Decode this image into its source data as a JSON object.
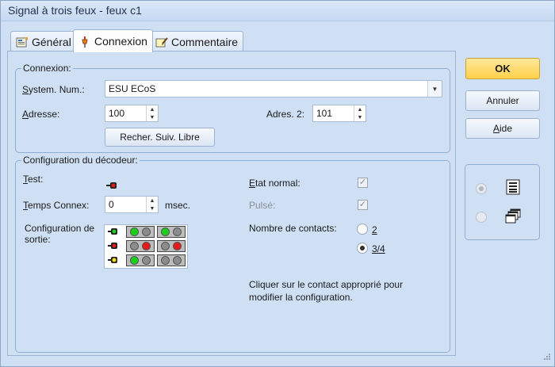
{
  "window": {
    "title": "Signal à trois feux - feux c1"
  },
  "tabs": [
    {
      "label": "Général",
      "icon": "general-icon"
    },
    {
      "label": "Connexion",
      "icon": "connection-icon"
    },
    {
      "label": "Commentaire",
      "icon": "comment-icon"
    }
  ],
  "connexion": {
    "legend": "Connexion:",
    "system_label_pre": "S",
    "system_label_post": "ystem. Num.:",
    "system_value": "ESU ECoS",
    "address_label_pre": "A",
    "address_label_post": "dresse:",
    "address_value": "100",
    "address2_label": "Adres. 2:",
    "address2_value": "101",
    "search_button": "Recher. Suiv. Libre"
  },
  "decoder": {
    "legend": "Configuration du décodeur:",
    "test_label_pre": "T",
    "test_label_post": "est:",
    "time_label_pre": "T",
    "time_label_post": "emps Connex:",
    "time_value": "0",
    "time_unit": "msec.",
    "config_label_line1": "Configuration de",
    "config_label_line2": "sortie:",
    "normal_state_label_pre": "E",
    "normal_state_label_post": "tat normal:",
    "pulse_label": "Pulsé:",
    "contacts_label": "Nombre de contacts:",
    "contacts_options": [
      "2",
      "3/4"
    ],
    "contacts_selected": "3/4",
    "hint_line1": "Cliquer sur le contact approprié pour",
    "hint_line2": "modifier la configuration."
  },
  "signal_rows": [
    {
      "head": "green",
      "cell1": [
        "green",
        "grey"
      ],
      "cell2": [
        "green",
        "grey"
      ]
    },
    {
      "head": "red",
      "cell1": [
        "grey",
        "red"
      ],
      "cell2": [
        "grey",
        "red"
      ]
    },
    {
      "head": "yellow",
      "cell1": [
        "green",
        "grey"
      ],
      "cell2": [
        "grey",
        "grey"
      ]
    }
  ],
  "buttons": {
    "ok": "OK",
    "cancel": "Annuler",
    "help_pre": "A",
    "help_post": "ide"
  },
  "view_options": [
    {
      "icon": "list-view-icon",
      "selected": true
    },
    {
      "icon": "window-stack-icon",
      "selected": false
    }
  ],
  "colors": {
    "accent_ok": "#fdd149",
    "panel": "#cfe0f5"
  }
}
